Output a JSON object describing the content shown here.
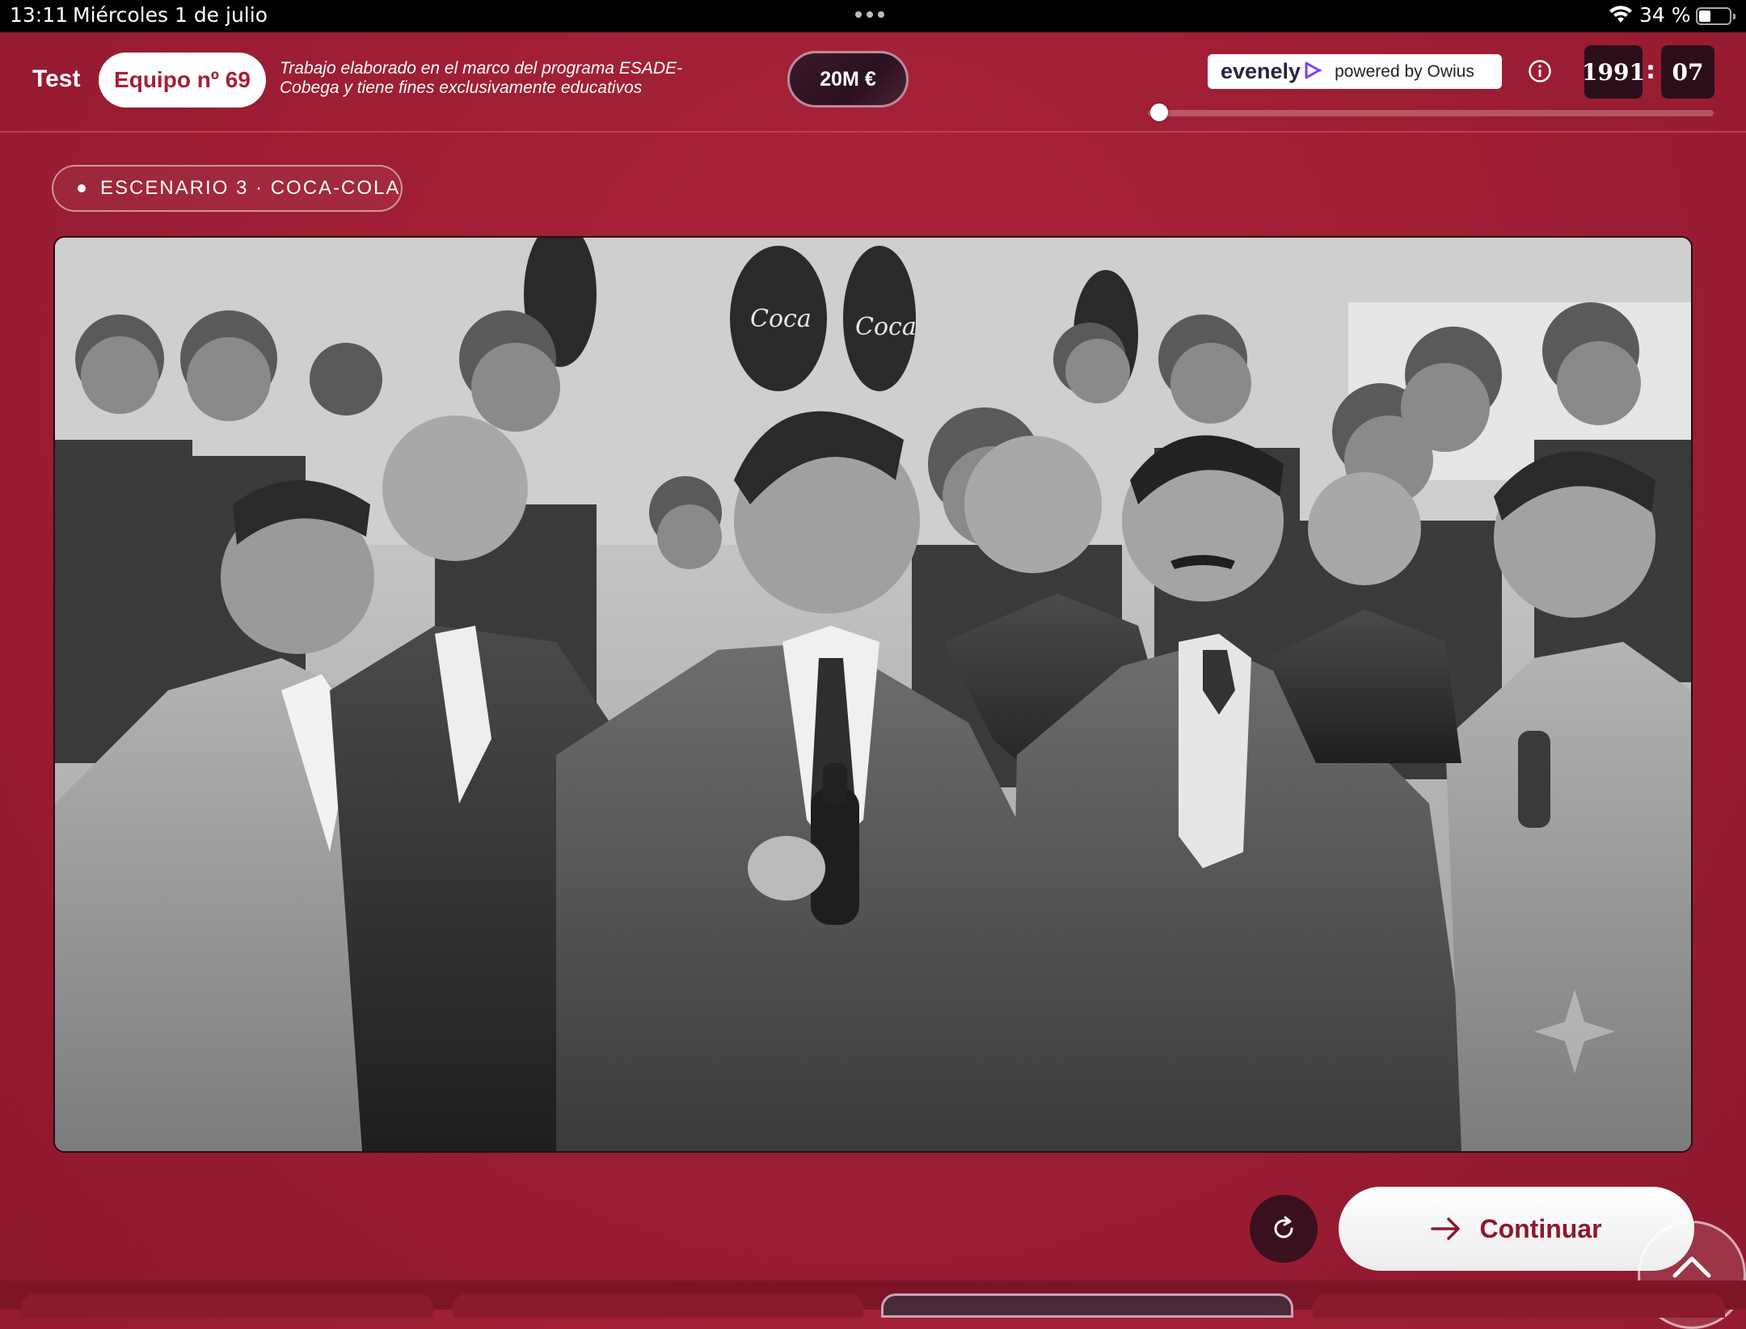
{
  "status_bar": {
    "time": "13:11",
    "date": "Miércoles 1 de julio",
    "battery": "34 %",
    "battery_fraction": 0.34,
    "icons": [
      "wifi-icon",
      "battery-icon",
      "multitask-dots-icon"
    ]
  },
  "header": {
    "app_label": "Test",
    "team": "Equipo nº 69",
    "disclaimer_line1": "Trabajo elaborado en el marco del programa ESADE-",
    "disclaimer_line2": "Cobega y tiene fines exclusivamente educativos",
    "budget": "20M €",
    "brand_name": "evenely",
    "brand_powered": "powered by Owius",
    "info_icon": "info-icon",
    "year": "1991",
    "month": "07",
    "timeline_progress": 0.02
  },
  "scenario": {
    "label": "ESCENARIO 3 · COCA-COLA"
  },
  "photo": {
    "description_icon": "historic-photo"
  },
  "actions": {
    "continue_label": "Continuar",
    "reload_icon": "refresh-icon",
    "scroll_top_icon": "chevron-up-icon"
  },
  "colors": {
    "background": "#9c1d33",
    "accent_dark": "#2a0f1a",
    "brand_purple": "#7b3cff"
  }
}
